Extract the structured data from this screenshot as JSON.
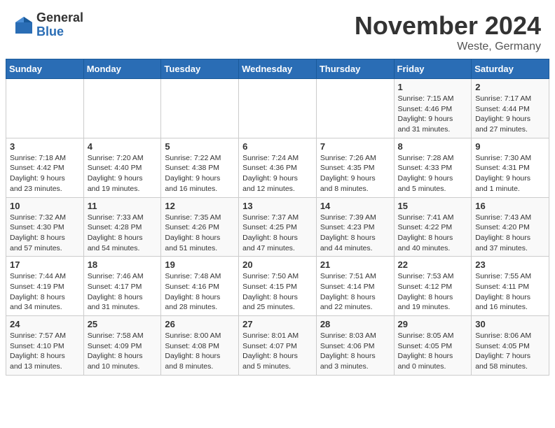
{
  "logo": {
    "general": "General",
    "blue": "Blue"
  },
  "title": "November 2024",
  "location": "Weste, Germany",
  "days_of_week": [
    "Sunday",
    "Monday",
    "Tuesday",
    "Wednesday",
    "Thursday",
    "Friday",
    "Saturday"
  ],
  "weeks": [
    [
      {
        "day": "",
        "info": ""
      },
      {
        "day": "",
        "info": ""
      },
      {
        "day": "",
        "info": ""
      },
      {
        "day": "",
        "info": ""
      },
      {
        "day": "",
        "info": ""
      },
      {
        "day": "1",
        "info": "Sunrise: 7:15 AM\nSunset: 4:46 PM\nDaylight: 9 hours\nand 31 minutes."
      },
      {
        "day": "2",
        "info": "Sunrise: 7:17 AM\nSunset: 4:44 PM\nDaylight: 9 hours\nand 27 minutes."
      }
    ],
    [
      {
        "day": "3",
        "info": "Sunrise: 7:18 AM\nSunset: 4:42 PM\nDaylight: 9 hours\nand 23 minutes."
      },
      {
        "day": "4",
        "info": "Sunrise: 7:20 AM\nSunset: 4:40 PM\nDaylight: 9 hours\nand 19 minutes."
      },
      {
        "day": "5",
        "info": "Sunrise: 7:22 AM\nSunset: 4:38 PM\nDaylight: 9 hours\nand 16 minutes."
      },
      {
        "day": "6",
        "info": "Sunrise: 7:24 AM\nSunset: 4:36 PM\nDaylight: 9 hours\nand 12 minutes."
      },
      {
        "day": "7",
        "info": "Sunrise: 7:26 AM\nSunset: 4:35 PM\nDaylight: 9 hours\nand 8 minutes."
      },
      {
        "day": "8",
        "info": "Sunrise: 7:28 AM\nSunset: 4:33 PM\nDaylight: 9 hours\nand 5 minutes."
      },
      {
        "day": "9",
        "info": "Sunrise: 7:30 AM\nSunset: 4:31 PM\nDaylight: 9 hours\nand 1 minute."
      }
    ],
    [
      {
        "day": "10",
        "info": "Sunrise: 7:32 AM\nSunset: 4:30 PM\nDaylight: 8 hours\nand 57 minutes."
      },
      {
        "day": "11",
        "info": "Sunrise: 7:33 AM\nSunset: 4:28 PM\nDaylight: 8 hours\nand 54 minutes."
      },
      {
        "day": "12",
        "info": "Sunrise: 7:35 AM\nSunset: 4:26 PM\nDaylight: 8 hours\nand 51 minutes."
      },
      {
        "day": "13",
        "info": "Sunrise: 7:37 AM\nSunset: 4:25 PM\nDaylight: 8 hours\nand 47 minutes."
      },
      {
        "day": "14",
        "info": "Sunrise: 7:39 AM\nSunset: 4:23 PM\nDaylight: 8 hours\nand 44 minutes."
      },
      {
        "day": "15",
        "info": "Sunrise: 7:41 AM\nSunset: 4:22 PM\nDaylight: 8 hours\nand 40 minutes."
      },
      {
        "day": "16",
        "info": "Sunrise: 7:43 AM\nSunset: 4:20 PM\nDaylight: 8 hours\nand 37 minutes."
      }
    ],
    [
      {
        "day": "17",
        "info": "Sunrise: 7:44 AM\nSunset: 4:19 PM\nDaylight: 8 hours\nand 34 minutes."
      },
      {
        "day": "18",
        "info": "Sunrise: 7:46 AM\nSunset: 4:17 PM\nDaylight: 8 hours\nand 31 minutes."
      },
      {
        "day": "19",
        "info": "Sunrise: 7:48 AM\nSunset: 4:16 PM\nDaylight: 8 hours\nand 28 minutes."
      },
      {
        "day": "20",
        "info": "Sunrise: 7:50 AM\nSunset: 4:15 PM\nDaylight: 8 hours\nand 25 minutes."
      },
      {
        "day": "21",
        "info": "Sunrise: 7:51 AM\nSunset: 4:14 PM\nDaylight: 8 hours\nand 22 minutes."
      },
      {
        "day": "22",
        "info": "Sunrise: 7:53 AM\nSunset: 4:12 PM\nDaylight: 8 hours\nand 19 minutes."
      },
      {
        "day": "23",
        "info": "Sunrise: 7:55 AM\nSunset: 4:11 PM\nDaylight: 8 hours\nand 16 minutes."
      }
    ],
    [
      {
        "day": "24",
        "info": "Sunrise: 7:57 AM\nSunset: 4:10 PM\nDaylight: 8 hours\nand 13 minutes."
      },
      {
        "day": "25",
        "info": "Sunrise: 7:58 AM\nSunset: 4:09 PM\nDaylight: 8 hours\nand 10 minutes."
      },
      {
        "day": "26",
        "info": "Sunrise: 8:00 AM\nSunset: 4:08 PM\nDaylight: 8 hours\nand 8 minutes."
      },
      {
        "day": "27",
        "info": "Sunrise: 8:01 AM\nSunset: 4:07 PM\nDaylight: 8 hours\nand 5 minutes."
      },
      {
        "day": "28",
        "info": "Sunrise: 8:03 AM\nSunset: 4:06 PM\nDaylight: 8 hours\nand 3 minutes."
      },
      {
        "day": "29",
        "info": "Sunrise: 8:05 AM\nSunset: 4:05 PM\nDaylight: 8 hours\nand 0 minutes."
      },
      {
        "day": "30",
        "info": "Sunrise: 8:06 AM\nSunset: 4:05 PM\nDaylight: 7 hours\nand 58 minutes."
      }
    ]
  ]
}
